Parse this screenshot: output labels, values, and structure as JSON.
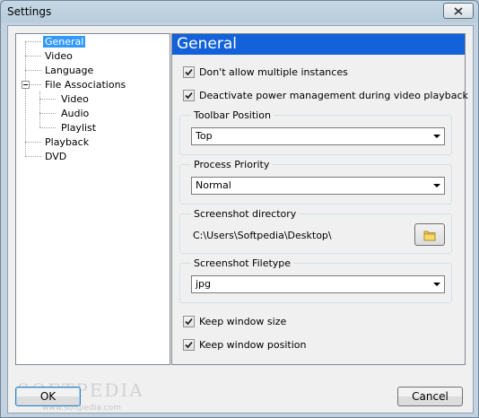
{
  "window": {
    "title": "Settings"
  },
  "tree": {
    "items": [
      {
        "label": "General",
        "selected": true
      },
      {
        "label": "Video"
      },
      {
        "label": "Language"
      },
      {
        "label": "File Associations"
      },
      {
        "label": "Video"
      },
      {
        "label": "Audio"
      },
      {
        "label": "Playlist"
      },
      {
        "label": "Playback"
      },
      {
        "label": "DVD"
      }
    ]
  },
  "panel": {
    "title": "General",
    "options": {
      "no_multiple_instances": {
        "label": "Don't allow multiple instances",
        "checked": true
      },
      "deactivate_power": {
        "label": "Deactivate power management during video playback",
        "checked": true
      },
      "keep_size": {
        "label": "Keep window size",
        "checked": true
      },
      "keep_position": {
        "label": "Keep window position",
        "checked": true
      }
    },
    "toolbar_position": {
      "label": "Toolbar Position",
      "value": "Top"
    },
    "process_priority": {
      "label": "Process Priority",
      "value": "Normal"
    },
    "screenshot_dir": {
      "label": "Screenshot directory",
      "value": "C:\\Users\\Softpedia\\Desktop\\"
    },
    "screenshot_filetype": {
      "label": "Screenshot Filetype",
      "value": "jpg"
    }
  },
  "buttons": {
    "ok": "OK",
    "cancel": "Cancel"
  },
  "watermark": {
    "text": "SOFTPEDIA",
    "url": "www.softpedia.com"
  },
  "icons": {
    "close": "close-icon",
    "folder": "folder-icon",
    "check": "checkmark-icon"
  },
  "colors": {
    "header": "#1362d9",
    "selection": "#3399ff"
  }
}
